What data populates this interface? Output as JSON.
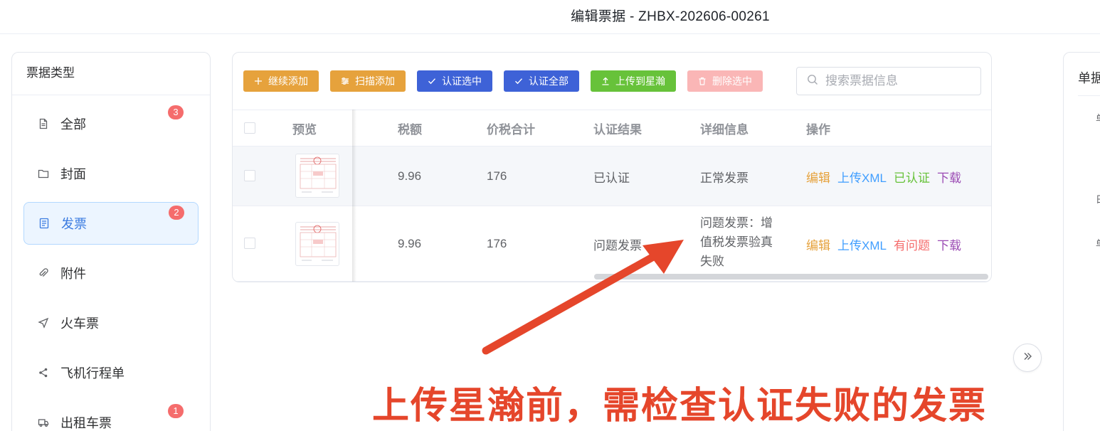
{
  "header": {
    "title": "编辑票据 - ZHBX-202606-00261"
  },
  "sidebar": {
    "title": "票据类型",
    "items": [
      {
        "label": "全部",
        "badge": "3",
        "icon": "document-icon"
      },
      {
        "label": "封面",
        "badge": "",
        "icon": "folder-icon"
      },
      {
        "label": "发票",
        "badge": "2",
        "icon": "invoice-icon",
        "active": true
      },
      {
        "label": "附件",
        "badge": "",
        "icon": "paperclip-icon"
      },
      {
        "label": "火车票",
        "badge": "",
        "icon": "send-icon"
      },
      {
        "label": "飞机行程单",
        "badge": "",
        "icon": "share-icon"
      },
      {
        "label": "出租车票",
        "badge": "1",
        "icon": "truck-icon"
      }
    ]
  },
  "toolbar": {
    "continue_add": "继续添加",
    "scan_add": "扫描添加",
    "verify_selected": "认证选中",
    "verify_all": "认证全部",
    "upload_xinghan": "上传到星瀚",
    "delete_selected": "删除选中"
  },
  "search": {
    "placeholder": "搜索票据信息"
  },
  "table": {
    "headers": {
      "preview": "预览",
      "tax": "税额",
      "total": "价税合计",
      "result": "认证结果",
      "detail": "详细信息",
      "actions": "操作"
    },
    "rows": [
      {
        "tax": "9.96",
        "total": "176",
        "result": "已认证",
        "detail": "正常发票",
        "actions": [
          "编辑",
          "上传XML",
          "已认证",
          "下载"
        ]
      },
      {
        "tax": "9.96",
        "total": "176",
        "result": "问题发票",
        "detail_lines": [
          "问题发票：增",
          "值税发票验真",
          "失败"
        ],
        "actions": [
          "编辑",
          "上传XML",
          "有问题",
          "下载"
        ]
      }
    ]
  },
  "right_panel": {
    "title": "单据",
    "fragments": [
      "单",
      "日",
      "单"
    ]
  },
  "annotation": {
    "text": "上传星瀚前，需检查认证失败的发票",
    "color": "#e5462b"
  }
}
